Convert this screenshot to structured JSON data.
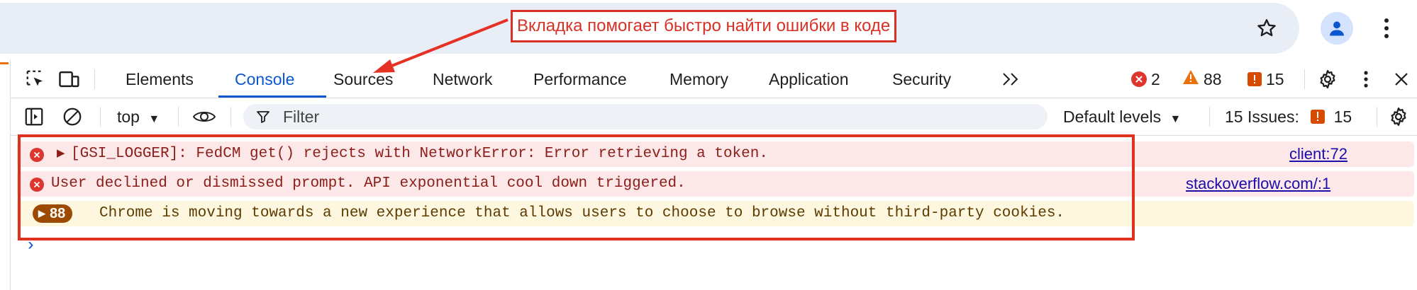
{
  "annotation": {
    "text": "Вкладка помогает быстро найти ошибки в коде",
    "color": "#d93025"
  },
  "browser": {
    "star_icon": "star-icon",
    "avatar_icon": "account-icon",
    "menu_icon": "kebab-menu-icon"
  },
  "devtools": {
    "tabs": [
      {
        "label": "Elements",
        "active": false
      },
      {
        "label": "Console",
        "active": true
      },
      {
        "label": "Sources",
        "active": false
      },
      {
        "label": "Network",
        "active": false
      },
      {
        "label": "Performance",
        "active": false
      },
      {
        "label": "Memory",
        "active": false
      },
      {
        "label": "Application",
        "active": false
      },
      {
        "label": "Security",
        "active": false
      }
    ],
    "more_tabs_icon": "chevron-double-right-icon",
    "counters": {
      "errors": "2",
      "warnings": "88",
      "issues": "15"
    },
    "accent_color": "#0b57d0"
  },
  "console_toolbar": {
    "context": "top",
    "filter_placeholder": "Filter",
    "levels": "Default levels",
    "issues_label": "15 Issues:",
    "issues_count": "15"
  },
  "messages": [
    {
      "type": "error",
      "text": "[GSI_LOGGER]: FedCM get() rejects with NetworkError: Error retrieving a token.",
      "source": "client:72",
      "expandable": true
    },
    {
      "type": "error",
      "text": "User declined or dismissed prompt. API exponential cool down triggered.",
      "source": "stackoverflow.com/:1",
      "expandable": false
    },
    {
      "type": "warning",
      "count": "88",
      "text": "Chrome is moving towards a new experience that allows users to choose to browse without third-party cookies."
    }
  ],
  "prompt_symbol": "›"
}
